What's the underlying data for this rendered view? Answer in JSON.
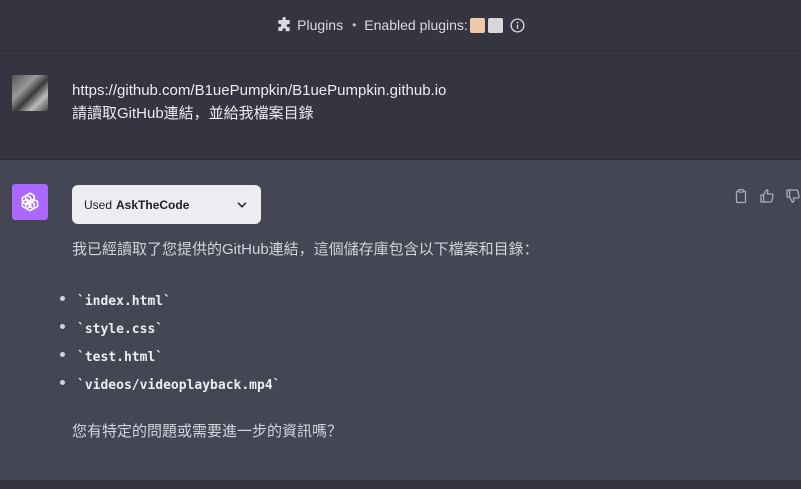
{
  "topbar": {
    "plugins_label": "Plugins",
    "separator": "•",
    "enabled_label": "Enabled plugins:"
  },
  "user_message": {
    "line1": "https://github.com/B1uePumpkin/B1uePumpkin.github.io",
    "line2": "請讀取GitHub連結，並給我檔案目錄"
  },
  "assistant_message": {
    "used_prefix": "Used",
    "used_plugin": "AskTheCode",
    "intro": "我已經讀取了您提供的GitHub連結，這個儲存庫包含以下檔案和目錄：",
    "files": [
      "`index.html`",
      "`style.css`",
      "`test.html`",
      "`videos/videoplayback.mp4`"
    ],
    "followup": "您有特定的問題或需要進一步的資訊嗎？"
  },
  "colors": {
    "page_bg": "#343541",
    "assistant_bg": "#444654",
    "gpt_avatar": "#ab68ff"
  },
  "icons": {
    "topbar": [
      "puzzle-icon",
      "plugin-icon-1",
      "plugin-icon-2",
      "info-icon"
    ],
    "actions": [
      "clipboard-icon",
      "thumbs-up-icon",
      "thumbs-down-icon"
    ],
    "dropdown": "chevron-down-icon",
    "assistant_avatar": "openai-logo-icon"
  }
}
